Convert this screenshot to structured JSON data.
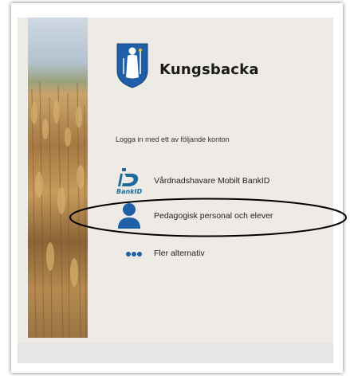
{
  "brand": {
    "name": "Kungsbacka",
    "logo_icon": "kungsbacka-coat-of-arms-icon",
    "accent": "#1f5fa8"
  },
  "login": {
    "intro": "Logga in med ett av följande konton",
    "options": [
      {
        "label": "Vårdnadshavare Mobilt BankID",
        "icon": "bankid-icon"
      },
      {
        "label": "Pedagogisk personal och elever",
        "icon": "user-icon"
      },
      {
        "label": "Fler alternativ",
        "icon": "more-dots-icon"
      }
    ]
  },
  "bankid_icon_text": "BankID",
  "colors": {
    "panel": "#eeeae6",
    "icon_blue": "#1f5fa8",
    "bankid_blue": "#1d6b9a",
    "annotation": "#000000"
  }
}
